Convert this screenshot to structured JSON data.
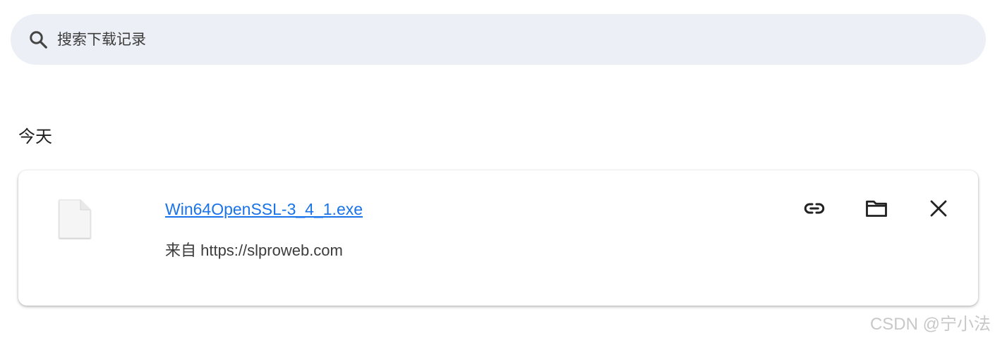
{
  "search": {
    "placeholder": "搜索下载记录",
    "icon": "search-icon"
  },
  "sections": [
    {
      "title": "今天",
      "downloads": [
        {
          "filename": "Win64OpenSSL-3_4_1.exe",
          "source_label": "来自 https://slproweb.com",
          "actions": {
            "copy_link_icon": "link-icon",
            "show_in_folder_icon": "folder-icon",
            "remove_icon": "close-icon"
          }
        }
      ]
    }
  ],
  "watermark": "CSDN @宁小法",
  "colors": {
    "link": "#1a73e8",
    "search_bg": "#eceff5"
  }
}
